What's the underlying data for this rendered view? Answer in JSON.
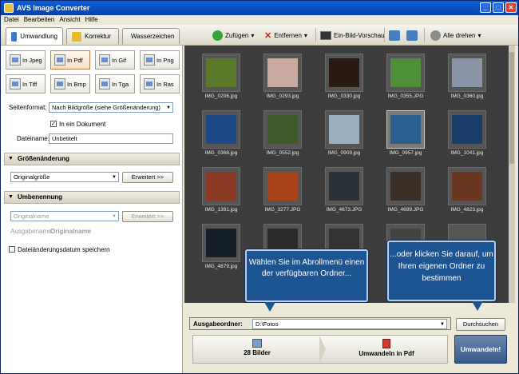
{
  "window": {
    "title": "AVS Image Converter",
    "min": "_",
    "max": "□",
    "close": "✕"
  },
  "menu": [
    "Datei",
    "Bearbeiten",
    "Ansicht",
    "Hilfe"
  ],
  "tabs": [
    {
      "label": "Umwandlung",
      "active": true
    },
    {
      "label": "Korrektur",
      "active": false
    },
    {
      "label": "Wasserzeichen",
      "active": false
    }
  ],
  "toolbar": {
    "add": "Zufügen",
    "remove": "Entfernen",
    "single_preview": "Ein-Bild-Vorschau",
    "rotate_all": "Alle drehen"
  },
  "formats": [
    {
      "label": "In Jpeg",
      "selected": false
    },
    {
      "label": "In Pdf",
      "selected": true
    },
    {
      "label": "In Gif",
      "selected": false
    },
    {
      "label": "In Png",
      "selected": false
    },
    {
      "label": "In Tiff",
      "selected": false
    },
    {
      "label": "In Bmp",
      "selected": false
    },
    {
      "label": "In Tga",
      "selected": false
    },
    {
      "label": "In Ras",
      "selected": false
    }
  ],
  "page_format": {
    "label": "Seitenformat:",
    "value": "Nach Bildgröße (siehe Größenänderung)"
  },
  "one_document": {
    "label": "In ein Dokument",
    "checked": true
  },
  "filename": {
    "label": "Dateiname:",
    "value": "Unbetitelt"
  },
  "resize": {
    "header": "Größenänderung",
    "value": "Originalgröße",
    "button": "Erweitert >>"
  },
  "rename": {
    "header": "Umbenennung",
    "value": "Originalname",
    "button": "Erweitert >>",
    "output_label": "Ausgabename:",
    "output_value": "Originalname"
  },
  "keep_date": {
    "label": "Dateiänderungsdatum speichern",
    "checked": false
  },
  "images": [
    {
      "name": "IMG_0206.jpg",
      "color": "#5a7a2a"
    },
    {
      "name": "IMG_0293.jpg",
      "color": "#c9a9a0"
    },
    {
      "name": "IMG_0330.jpg",
      "color": "#2a1a12"
    },
    {
      "name": "IMG_0355.JPG",
      "color": "#4f8f3a"
    },
    {
      "name": "IMG_0360.jpg",
      "color": "#8a95a8"
    },
    {
      "name": "IMG_0368.jpg",
      "color": "#1e4a8a"
    },
    {
      "name": "IMG_0552.jpg",
      "color": "#3d5a28"
    },
    {
      "name": "IMG_0909.jpg",
      "color": "#9ab0c0"
    },
    {
      "name": "IMG_0957.jpg",
      "color": "#2b5f8f"
    },
    {
      "name": "IMG_1041.jpg",
      "color": "#1a3e6a"
    },
    {
      "name": "IMG_1391.jpg",
      "color": "#8a3a24"
    },
    {
      "name": "IMG_3277.JPG",
      "color": "#a8421a"
    },
    {
      "name": "IMG_4673.JPG",
      "color": "#2a3238"
    },
    {
      "name": "IMG_4699.JPG",
      "color": "#3a3028"
    },
    {
      "name": "IMG_4823.jpg",
      "color": "#6a3820"
    },
    {
      "name": "IMG_4879.jpg",
      "color": "#15202a"
    },
    {
      "name": "IMG_",
      "color": "#2a2a2a"
    },
    {
      "name": "IMG_",
      "color": "#333"
    },
    {
      "name": "IMG_",
      "color": "#444"
    },
    {
      "name": "IMG_",
      "color": "#555"
    }
  ],
  "selected_image": "IMG_0957.jpg",
  "output_folder": {
    "label": "Ausgabeordner:",
    "value": "D:\\Fotos",
    "browse": "Durchsuchen"
  },
  "action": {
    "count": "28 Bilder",
    "convert_to": "Umwandeln in Pdf",
    "convert": "Umwandeln!"
  },
  "callouts": {
    "left": "Wählen Sie im Abrollmenü einen der verfügbaren Ordner...",
    "right": "...oder klicken Sie darauf, um Ihren eigenen Ordner zu bestimmen"
  }
}
